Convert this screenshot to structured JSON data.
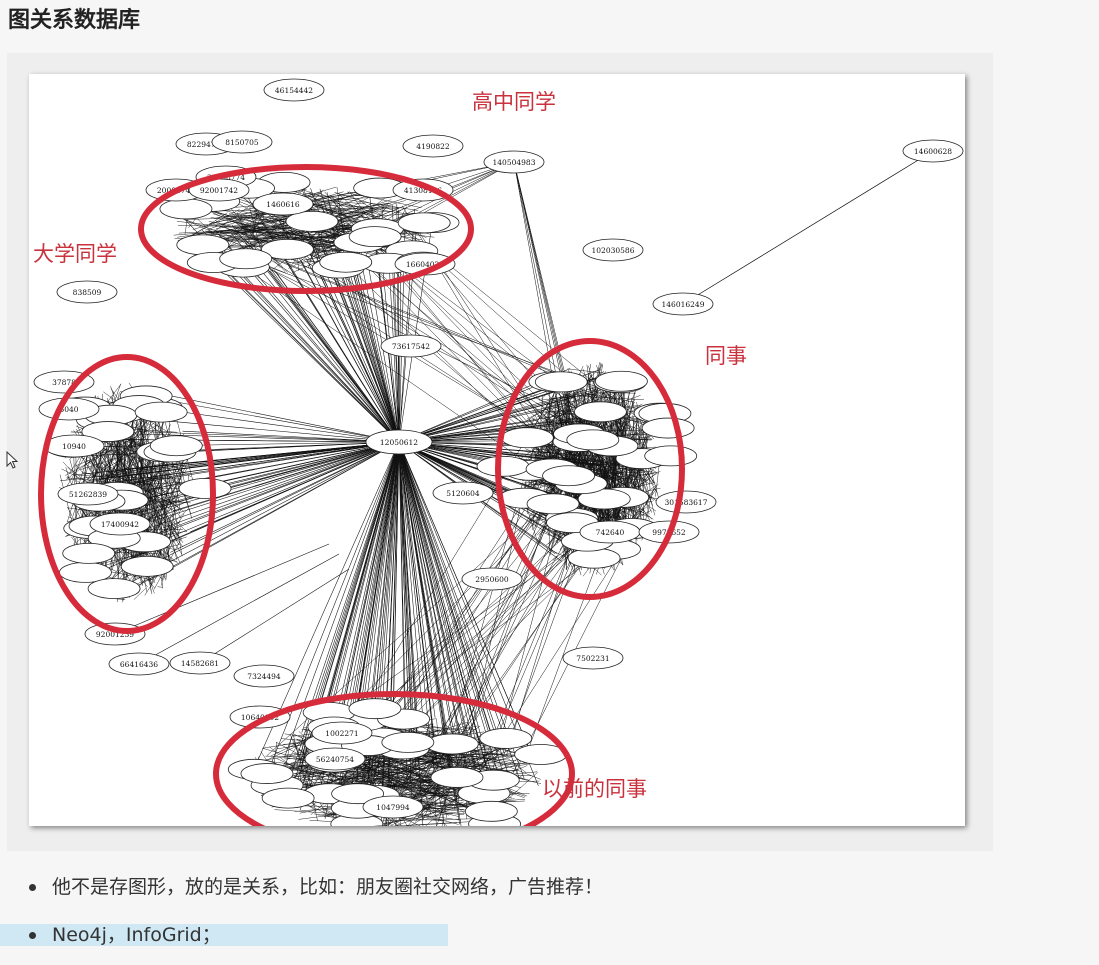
{
  "title": "图关系数据库",
  "figure": {
    "cluster_labels": {
      "highschool": "高中同学",
      "college": "大学同学",
      "colleagues": "同事",
      "former_colleagues": "以前的同事"
    },
    "center_node": "12050612",
    "named_nodes": [
      "46154442",
      "82294777",
      "8150705",
      "32008774",
      "20001742",
      "92001742",
      "4190822",
      "1460616",
      "41308136",
      "140504983",
      "14600628",
      "16604023",
      "73617542",
      "102030586",
      "146016249",
      "838509",
      "37878",
      "5040",
      "10940",
      "51262839",
      "17400942",
      "5120604",
      "2950600",
      "92001239",
      "66416436",
      "14582681",
      "7324494",
      "10640002",
      "1002271",
      "56240754",
      "1047994",
      "301583617",
      "742640",
      "9973652",
      "7502231"
    ]
  },
  "colors": {
    "accent_red": "#d62b3a",
    "label_red": "#c9323d"
  },
  "bullets": [
    "他不是存图形，放的是关系，比如：朋友圈社交网络，广告推荐！",
    "Neo4j，InfoGrid；"
  ]
}
